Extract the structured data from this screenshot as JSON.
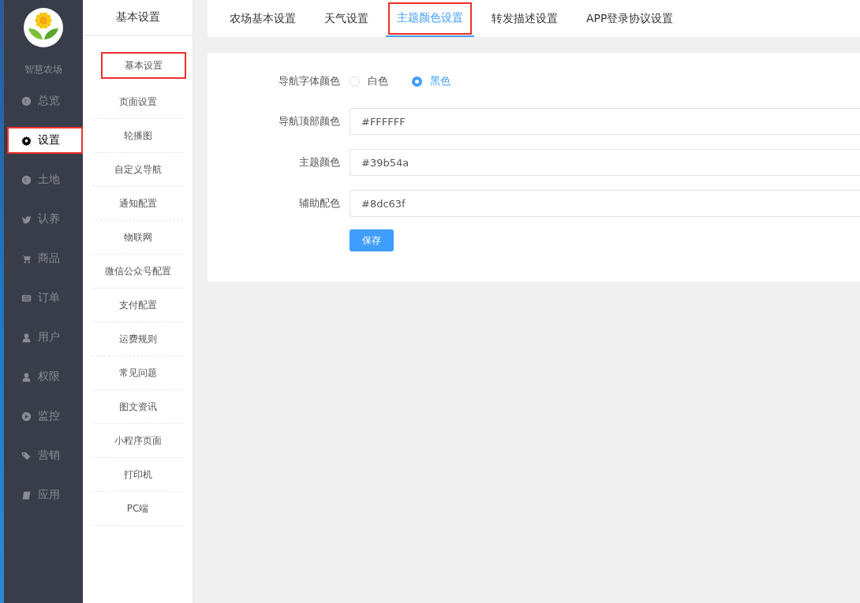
{
  "sidebar": {
    "brand": "智慧农场",
    "items": [
      {
        "label": "总览",
        "selected": false,
        "highlighted": false
      },
      {
        "label": "设置",
        "selected": true,
        "highlighted": true
      },
      {
        "label": "土地",
        "selected": false,
        "highlighted": false
      },
      {
        "label": "认养",
        "selected": false,
        "highlighted": false
      },
      {
        "label": "商品",
        "selected": false,
        "highlighted": false
      },
      {
        "label": "订单",
        "selected": false,
        "highlighted": false
      },
      {
        "label": "用户",
        "selected": false,
        "highlighted": false
      },
      {
        "label": "权限",
        "selected": false,
        "highlighted": false
      },
      {
        "label": "监控",
        "selected": false,
        "highlighted": false
      },
      {
        "label": "营销",
        "selected": false,
        "highlighted": false
      },
      {
        "label": "应用",
        "selected": false,
        "highlighted": false
      }
    ]
  },
  "submenu": {
    "title": "基本设置",
    "items": [
      {
        "label": "基本设置",
        "highlighted": true
      },
      {
        "label": "页面设置",
        "highlighted": false
      },
      {
        "label": "轮播图",
        "highlighted": false
      },
      {
        "label": "自定义导航",
        "highlighted": false
      },
      {
        "label": "通知配置",
        "highlighted": false
      },
      {
        "label": "物联网",
        "highlighted": false
      },
      {
        "label": "微信公众号配置",
        "highlighted": false
      },
      {
        "label": "支付配置",
        "highlighted": false
      },
      {
        "label": "运费规则",
        "highlighted": false
      },
      {
        "label": "常见问题",
        "highlighted": false
      },
      {
        "label": "图文资讯",
        "highlighted": false
      },
      {
        "label": "小程序页面",
        "highlighted": false
      },
      {
        "label": "打印机",
        "highlighted": false
      },
      {
        "label": "PC端",
        "highlighted": false
      }
    ]
  },
  "tabs": [
    {
      "label": "农场基本设置",
      "selected": false,
      "highlighted": false
    },
    {
      "label": "天气设置",
      "selected": false,
      "highlighted": false
    },
    {
      "label": "主题颜色设置",
      "selected": true,
      "highlighted": true
    },
    {
      "label": "转发描述设置",
      "selected": false,
      "highlighted": false
    },
    {
      "label": "APP登录协议设置",
      "selected": false,
      "highlighted": false
    }
  ],
  "form": {
    "radio": {
      "label": "导航字体颜色",
      "options": [
        {
          "label": "白色",
          "selected": false
        },
        {
          "label": "黑色",
          "selected": true
        }
      ]
    },
    "fields": [
      {
        "label": "导航顶部颜色",
        "value": "#FFFFFF"
      },
      {
        "label": "主题颜色",
        "value": "#39b54a"
      },
      {
        "label": "辅助配色",
        "value": "#8dc63f"
      }
    ],
    "save_button": "保存"
  }
}
